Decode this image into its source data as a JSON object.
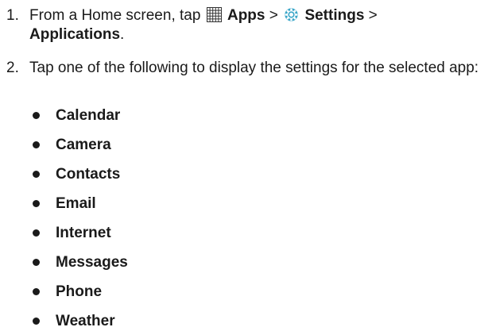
{
  "steps": [
    {
      "number": "1.",
      "text_before": "From a Home screen, tap",
      "apps_icon": "apps-grid-icon",
      "apps_label": "Apps",
      "separator1": ">",
      "settings_icon": "settings-gear-icon",
      "settings_label": "Settings",
      "separator2": ">",
      "applications_label": "Applications",
      "period": "."
    },
    {
      "number": "2.",
      "text": "Tap one of the following to display the settings for the selected app:"
    }
  ],
  "apps": [
    {
      "label": "Calendar"
    },
    {
      "label": "Camera"
    },
    {
      "label": "Contacts"
    },
    {
      "label": "Email"
    },
    {
      "label": "Internet"
    },
    {
      "label": "Messages"
    },
    {
      "label": "Phone"
    },
    {
      "label": "Weather"
    }
  ],
  "colors": {
    "text": "#1a1a1a",
    "settings_icon": "#3aa6c8"
  }
}
